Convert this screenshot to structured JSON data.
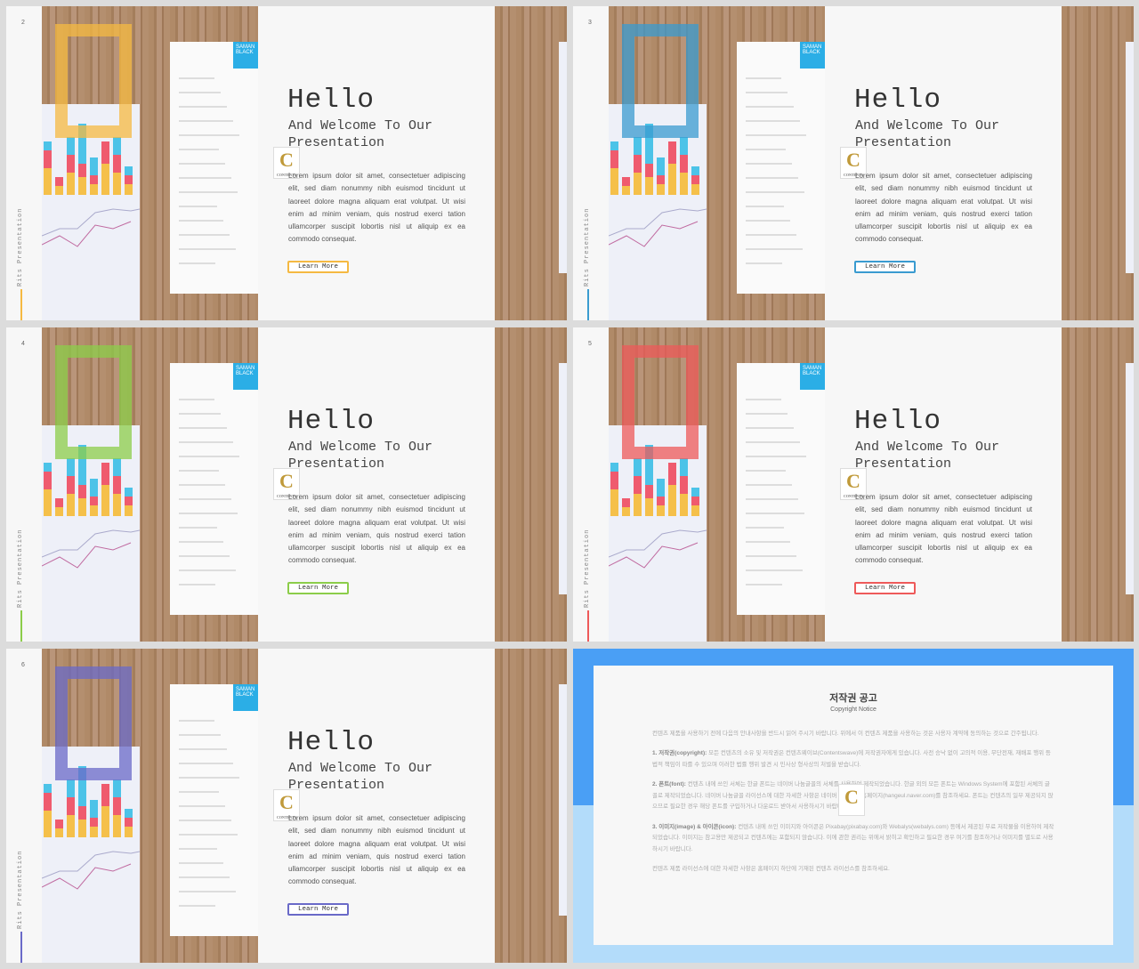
{
  "slides": [
    {
      "number": "2",
      "accent": "#f5b942"
    },
    {
      "number": "3",
      "accent": "#3a9bd0"
    },
    {
      "number": "4",
      "accent": "#8ccd4a"
    },
    {
      "number": "5",
      "accent": "#ee5a5a"
    },
    {
      "number": "6",
      "accent": "#6a6ac8"
    }
  ],
  "template": {
    "side_label": "Rits Presentation",
    "title": "Hello",
    "subtitle": "And Welcome To Our Presentation",
    "body": "Lorem ipsum dolor sit amet, consectetuer adipiscing elit, sed diam nonummy nibh euismod tincidunt ut laoreet dolore magna aliquam erat volutpat. Ut wisi enim ad minim veniam, quis nostrud exerci tation ullamcorper suscipit lobortis nisl ut aliquip ex ea commodo consequat.",
    "button": "Learn More",
    "resume_name": "SAMAN BLACK",
    "logo_letter": "C",
    "logo_text": "CONTENTS"
  },
  "copyright": {
    "title": "저작권 공고",
    "subtitle": "Copyright Notice",
    "intro": "컨텐츠 제품을 사용하기 전에 다음의 안내사항을 반드시 읽어 주시기 바랍니다. 위에서 이 컨텐츠 제품을 사용하는 것은 사용자 계약에 동의하는 것으로 간주됩니다.",
    "item1_head": "1. 저작권(copyright):",
    "item1": "모든 컨텐츠의 소유 및 저작권은 컨텐츠웨이브(Contentswave)에 저작권자에게 있습니다. 사전 승낙 없이 고의적 이용, 무단전재, 재배포 행위 등 법적 책임이 따를 수 있으며 이러한 법률 행위 발견 시 민사상 형사상의 처벌을 받습니다.",
    "item2_head": "2. 폰트(font):",
    "item2": "컨텐츠 내에 쓰인 서체는 한글 폰트는 네이버 나눔글꼴의 서체를 사용하여 제작되었습니다. 한글 외의 모든 폰트는 Windows System에 포함된 서체의 글꼴로 제작되었습니다. 네이버 나눔글꼴 라이선스에 대한 자세한 사항은 네이버 나눔글꼴 홈페이지(hangeul.naver.com)를 참조하세요. 폰트는 컨텐츠의 일부 제공되지 않으므로 필요한 경우 해당 폰트를 구입하거나 다운로드 받아서 사용하시기 바랍니다.",
    "item3_head": "3. 이미지(image) & 아이콘(icon):",
    "item3": "컨텐츠 내에 쓰인 이미지와 아이콘은 Pixabay(pixabay.com)와 Webalys(webalys.com) 등에서 제공된 무료 저작물을 이용하여 제작되었습니다. 이미지는 참고용만 제공되고 컨텐츠에는 포함되지 않습니다. 이에 관한 권리는 위에서 밝히고 확인하고 필요한 경우 여기를 참조하거나 이미지를 별도로 사용하시기 바랍니다.",
    "footer": "컨텐츠 제품 라이선스에 대한 자세한 사항은 홈페이지 하단에 기재된 컨텐츠 라이선스를 참조하세요.",
    "top_color": "#4a9ff5",
    "bottom_color": "#b3dcfa"
  }
}
